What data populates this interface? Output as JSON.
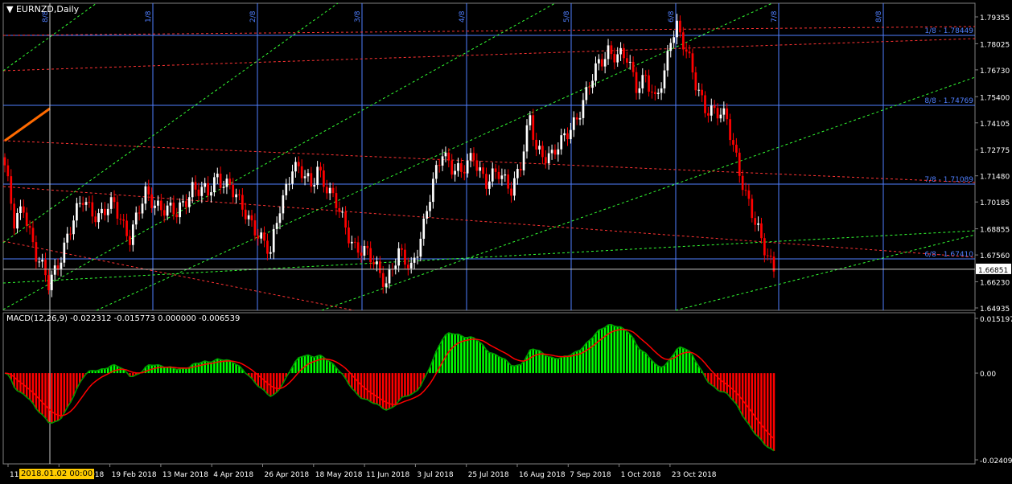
{
  "window": {
    "title": "EURNZD,Daily"
  },
  "macd_label": "MACD(12,26,9) -0.022312 -0.015773 0.000000 -0.006539",
  "crosshair_time": "2018.01.02 00:00",
  "colors": {
    "background": "#000000",
    "bull": "#ffffff",
    "bear": "#ff0000",
    "grid": "#4f7fff",
    "fan_red": "#ff3333",
    "fan_green": "#33ff33",
    "macd_pos": "#00ff00",
    "macd_neg": "#ff0000",
    "signal": "#ff0000",
    "macd_line": "#009900"
  },
  "chart_data": [
    {
      "type": "candlestick",
      "symbol": "EURNZD",
      "timeframe": "Daily",
      "y_ticks": [
        "1.79355",
        "1.78025",
        "1.76730",
        "1.75400",
        "1.74105",
        "1.72775",
        "1.71480",
        "1.70185",
        "1.68855",
        "1.67560",
        "1.66230",
        "1.64935"
      ],
      "current_price": "1.66851",
      "ylim": [
        1.6494,
        1.7955
      ],
      "x_ticks": [
        "11 Dec 2017",
        "26 Jan 2018",
        "19 Feb 2018",
        "13 Mar 2018",
        "4 Apr 2018",
        "26 Apr 2018",
        "18 May 2018",
        "11 Jun 2018",
        "3 Jul 2018",
        "25 Jul 2018",
        "16 Aug 2018",
        "7 Sep 2018",
        "1 Oct 2018",
        "23 Oct 2018"
      ],
      "gann_time_labels": [
        "8/8",
        "1/8",
        "2/8",
        "3/8",
        "4/8",
        "5/8",
        "6/8",
        "7/8",
        "8/8"
      ],
      "gann_price_labels": [
        "1/8 - 1.78449",
        "8/8 - 1.74769",
        "7/8 - 1.71089",
        "6/8 - 1.67410"
      ],
      "price_levels": [
        1.78449,
        1.74769,
        1.71089,
        1.6741
      ],
      "waypoints": [
        [
          0,
          1.72
        ],
        [
          3,
          1.69
        ],
        [
          6,
          1.7
        ],
        [
          10,
          1.676
        ],
        [
          14,
          1.66
        ],
        [
          17,
          1.672
        ],
        [
          20,
          1.685
        ],
        [
          25,
          1.703
        ],
        [
          30,
          1.695
        ],
        [
          35,
          1.7
        ],
        [
          40,
          1.685
        ],
        [
          45,
          1.705
        ],
        [
          50,
          1.7
        ],
        [
          55,
          1.695
        ],
        [
          60,
          1.71
        ],
        [
          65,
          1.705
        ],
        [
          68,
          1.715
        ],
        [
          72,
          1.71
        ],
        [
          75,
          1.7
        ],
        [
          80,
          1.69
        ],
        [
          85,
          1.675
        ],
        [
          88,
          1.7
        ],
        [
          92,
          1.72
        ],
        [
          95,
          1.715
        ],
        [
          98,
          1.71
        ],
        [
          100,
          1.72
        ],
        [
          104,
          1.705
        ],
        [
          106,
          1.7
        ],
        [
          112,
          1.68
        ],
        [
          118,
          1.672
        ],
        [
          122,
          1.663
        ],
        [
          126,
          1.675
        ],
        [
          130,
          1.67
        ],
        [
          134,
          1.69
        ],
        [
          137,
          1.71
        ],
        [
          140,
          1.728
        ],
        [
          143,
          1.72
        ],
        [
          146,
          1.715
        ],
        [
          150,
          1.725
        ],
        [
          154,
          1.712
        ],
        [
          158,
          1.715
        ],
        [
          162,
          1.71
        ],
        [
          165,
          1.72
        ],
        [
          168,
          1.742
        ],
        [
          170,
          1.728
        ],
        [
          175,
          1.725
        ],
        [
          178,
          1.73
        ],
        [
          183,
          1.745
        ],
        [
          186,
          1.755
        ],
        [
          190,
          1.77
        ],
        [
          193,
          1.778
        ],
        [
          196,
          1.774
        ],
        [
          199,
          1.772
        ],
        [
          202,
          1.76
        ],
        [
          205,
          1.765
        ],
        [
          208,
          1.75
        ],
        [
          211,
          1.765
        ],
        [
          213,
          1.785
        ],
        [
          215,
          1.79
        ],
        [
          218,
          1.775
        ],
        [
          221,
          1.76
        ],
        [
          224,
          1.75
        ],
        [
          228,
          1.745
        ],
        [
          231,
          1.742
        ],
        [
          234,
          1.725
        ],
        [
          237,
          1.705
        ],
        [
          240,
          1.69
        ],
        [
          243,
          1.68
        ],
        [
          246,
          1.67
        ]
      ]
    },
    {
      "type": "line",
      "indicator": "MACD(12,26,9)",
      "y_ticks": [
        "0.015197",
        "0.00",
        "-0.024098"
      ],
      "ylim": [
        -0.0249,
        0.0165
      ],
      "series": [
        {
          "name": "MACD",
          "role": "histogram"
        },
        {
          "name": "Signal",
          "role": "line"
        }
      ]
    }
  ]
}
